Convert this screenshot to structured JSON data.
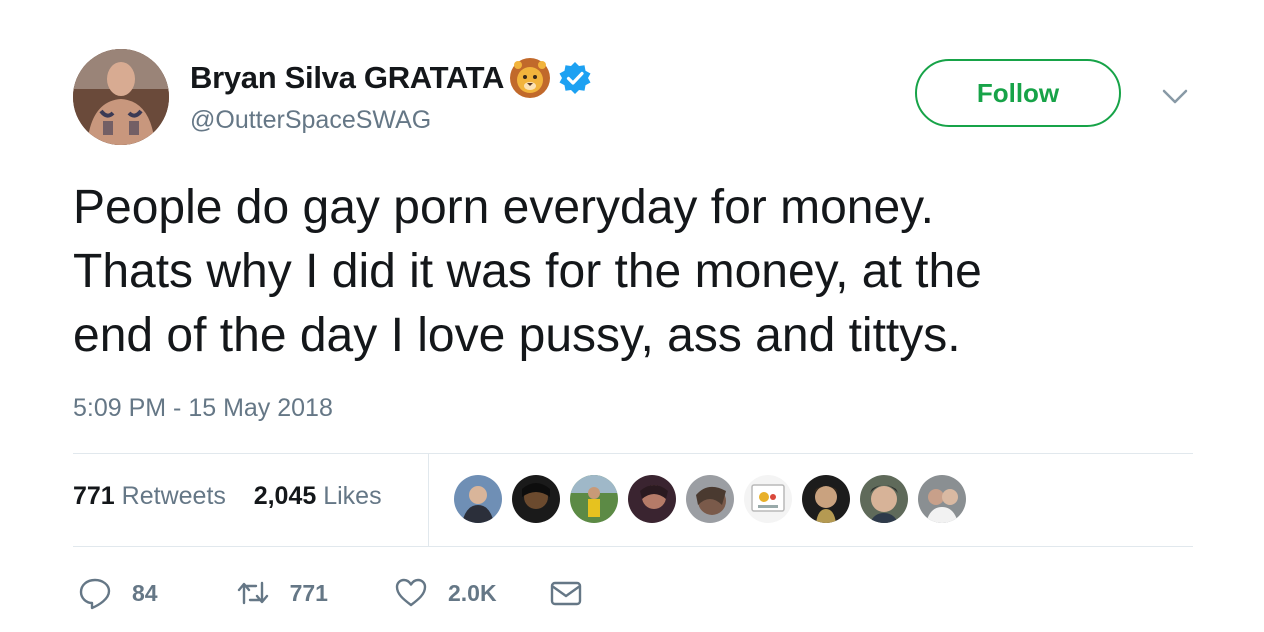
{
  "user": {
    "display_name": "Bryan Silva GRATATA",
    "handle": "@OutterSpaceSWAG"
  },
  "follow_label": "Follow",
  "tweet": {
    "lines": [
      "People do gay porn everyday for money.",
      "Thats why I did it was for the money, at the",
      "end of the day I love pussy, ass and tittys."
    ],
    "timestamp": "5:09 PM - 15 May 2018"
  },
  "stats": {
    "retweets_count": "771",
    "retweets_label": "Retweets",
    "likes_count": "2,045",
    "likes_label": "Likes"
  },
  "actions": {
    "replies": "84",
    "retweets": "771",
    "likes": "2.0K"
  },
  "colors": {
    "follow_green": "#17a348",
    "verified_blue": "#1da1f2",
    "muted_text": "#657786"
  }
}
